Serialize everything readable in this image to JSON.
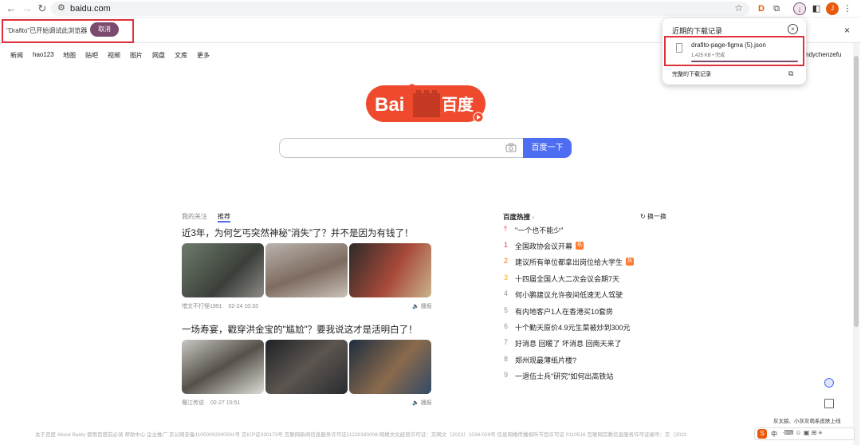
{
  "browser": {
    "url": "baidu.com",
    "ext_d_label": "D",
    "profile_badge": "J"
  },
  "infobar": {
    "debug_message": "\"Drafito\"已开始调试此浏览器",
    "cancel_label": "取消",
    "close_label": "×"
  },
  "top_nav": {
    "items": [
      "新闻",
      "hao123",
      "地图",
      "贴吧",
      "视频",
      "图片",
      "网盘",
      "文库",
      "更多"
    ],
    "username": "ndychenzefu"
  },
  "logo": {
    "left_text": "Bai",
    "right_text": "百度"
  },
  "search": {
    "button_label": "百度一下"
  },
  "feed": {
    "tabs": [
      "我的关注",
      "推荐"
    ],
    "articles": [
      {
        "title": "近3年，为何乞丐突然神秘\"消失\"了？并不是因为有钱了！",
        "source": "惜文不打怪1991",
        "time": "02-24 10:33",
        "report": "播报"
      },
      {
        "title": "一场寿宴，戳穿洪金宝的\"尴尬\"？要我说这才是活明白了！",
        "source": "偃江传说",
        "time": "02-27 15:51",
        "report": "播报"
      }
    ]
  },
  "hot": {
    "title": "百度热搜",
    "refresh": "换一换",
    "pinned": "\"一个也不能少\"",
    "items": [
      {
        "rank": "1",
        "text": "全国政协会议开幕",
        "badge": "热",
        "color": "#fe2d46"
      },
      {
        "rank": "2",
        "text": "建议所有单位都拿出岗位给大学生",
        "badge": "热",
        "color": "#ff6600"
      },
      {
        "rank": "3",
        "text": "十四届全国人大二次会议会期7天",
        "badge": "",
        "color": "#faa90e"
      },
      {
        "rank": "4",
        "text": "何小鹏建议允许夜间低速无人驾驶",
        "badge": "",
        "color": "#9195a3"
      },
      {
        "rank": "5",
        "text": "有内地客户1人在香港买10套房",
        "badge": "",
        "color": "#9195a3"
      },
      {
        "rank": "6",
        "text": "十个勤天原价4.9元生菜被炒到300元",
        "badge": "",
        "color": "#9195a3"
      },
      {
        "rank": "7",
        "text": "好消息 回暖了 坏消息 回南天来了",
        "badge": "",
        "color": "#9195a3"
      },
      {
        "rank": "8",
        "text": "郑州现最薄纸片楼?",
        "badge": "",
        "color": "#9195a3"
      },
      {
        "rank": "9",
        "text": "一退伍士兵\"研究\"如何出高铁站",
        "badge": "",
        "color": "#9195a3"
      }
    ]
  },
  "downloads": {
    "title": "近期的下载记录",
    "file_name": "drafito-page-figma (5).json",
    "file_status": "1,425 KB • 完成",
    "all_label": "完整的下载记录"
  },
  "footer": {
    "text": "关于百度   About Baidu   使用百度前必读   帮助中心   企业推广   京公网安备11000002000001号   京ICP证030173号   互联网新闻信息服务许可证11220180008   网络文化经营许可证：京网文〔2023〕1034-029号   信息网络传播视听节目许可证 0110516   互联网宗教信息服务许可证编号：京（2022"
  },
  "ime": {
    "hint": "灰太狼、小灰灰萌系皮肤上线",
    "lang": "中"
  }
}
